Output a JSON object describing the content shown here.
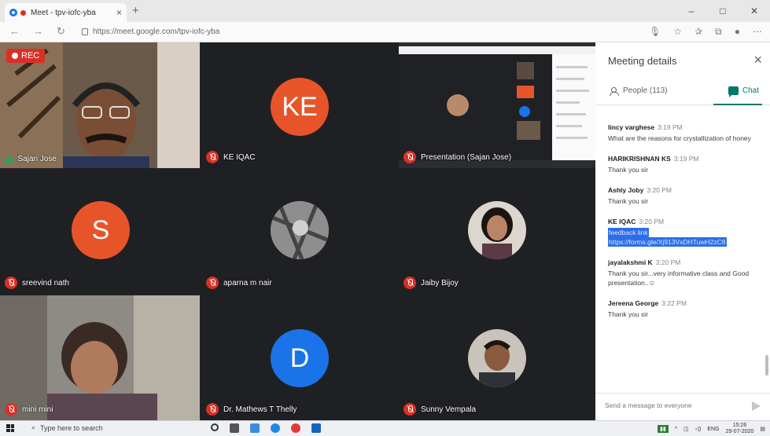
{
  "browser": {
    "tab_title": "Meet - tpv-iofc-yba",
    "tab_close": "×",
    "new_tab": "+",
    "url": "https://meet.google.com/tpv-iofc-yba",
    "window_controls": [
      "–",
      "□",
      "✕"
    ]
  },
  "recording_label": "REC",
  "tiles": [
    {
      "name": "Sajan Jose",
      "mic": "speaking"
    },
    {
      "name": "KE IQAC",
      "initials": "KE",
      "color": "#e8542a",
      "mic": "muted"
    },
    {
      "name": "Presentation (Sajan Jose)",
      "mic": "muted"
    },
    {
      "name": "sreevind nath",
      "initials": "S",
      "color": "#e8542a",
      "mic": "muted"
    },
    {
      "name": "aparna m nair",
      "mic": "muted"
    },
    {
      "name": "Jaiby Bijoy",
      "mic": "muted"
    },
    {
      "name": "mini mini",
      "mic": "muted"
    },
    {
      "name": "Dr. Mathews T Thelly",
      "initials": "D",
      "color": "#1a73e8",
      "mic": "muted"
    },
    {
      "name": "Sunny Vempala",
      "mic": "muted"
    }
  ],
  "panel": {
    "title": "Meeting details",
    "close": "×",
    "people_tab": "People (113)",
    "chat_tab": "Chat",
    "messages": [
      {
        "sender": "lincy varghese",
        "time": "3:19 PM",
        "text": "What are the reasons for crystallization of honey"
      },
      {
        "sender": "HARIKRISHNAN KS",
        "time": "3:19 PM",
        "text": "Thank you sir"
      },
      {
        "sender": "Ashly Joby",
        "time": "3:20 PM",
        "text": "Thank you sir"
      },
      {
        "sender": "KE IQAC",
        "time": "3:20 PM",
        "link_label": "feedback link",
        "link_url": "https://forms.gle/Xj913VxDHTuwH2zC8"
      },
      {
        "sender": "jayalakshmi K",
        "time": "3:20 PM",
        "text": "Thank you sir...very informative class and Good presentation..☺"
      },
      {
        "sender": "Jereena George",
        "time": "3:22 PM",
        "text": "Thank you sir"
      }
    ],
    "composer_placeholder": "Send a message to everyone"
  },
  "taskbar": {
    "search_placeholder": "Type here to search",
    "language": "ENG",
    "time": "15:26",
    "date": "29-07-2020"
  },
  "colors": {
    "stage_bg": "#202124",
    "tile_bg": "#3c4043",
    "mute_red": "#d93025",
    "chat_accent": "#00796b",
    "link_highlight": "#2c6ee6"
  }
}
